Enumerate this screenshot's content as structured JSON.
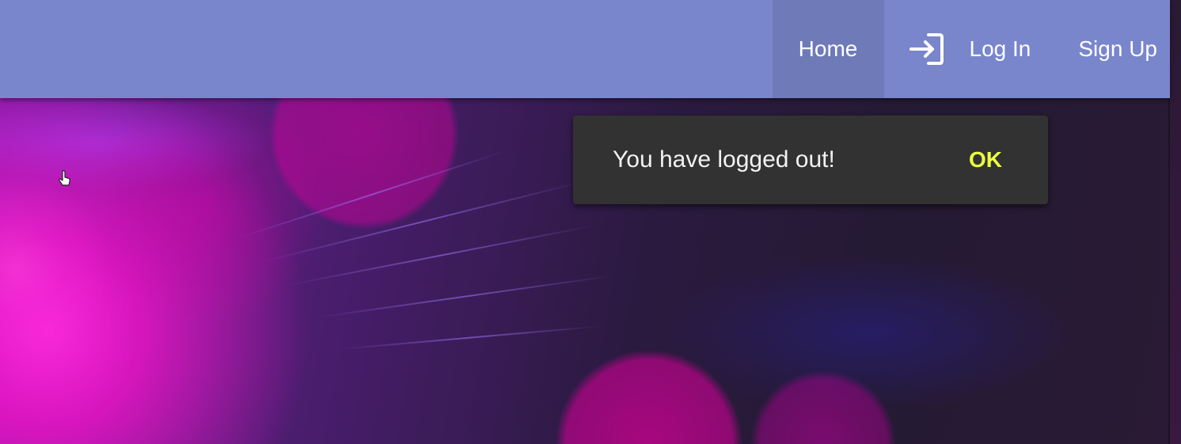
{
  "navbar": {
    "items": [
      {
        "label": "Home",
        "active": true
      },
      {
        "label": "Log In",
        "icon": "login-icon"
      },
      {
        "label": "Sign Up"
      }
    ]
  },
  "snackbar": {
    "message": "You have logged out!",
    "action_label": "OK"
  },
  "colors": {
    "appbar": "#7986cb",
    "appbar_active": "#6f7bb8",
    "snackbar_bg": "#323232",
    "snackbar_action": "#eeff41"
  }
}
